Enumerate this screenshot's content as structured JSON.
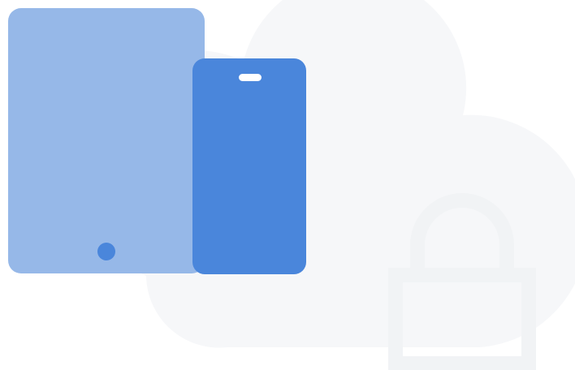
{
  "illustration": {
    "subject": "devices-with-cloud-and-lock",
    "icons": [
      "cloud-icon",
      "lock-icon",
      "tablet-icon",
      "phone-icon"
    ],
    "colors": {
      "background": "#ffffff",
      "cloud": "#f6f7f9",
      "lock": "#f1f3f5",
      "tablet_body": "#96b8e8",
      "tablet_home_button": "#4a86db",
      "phone_body": "#4a86db",
      "phone_speaker": "#ffffff"
    }
  }
}
